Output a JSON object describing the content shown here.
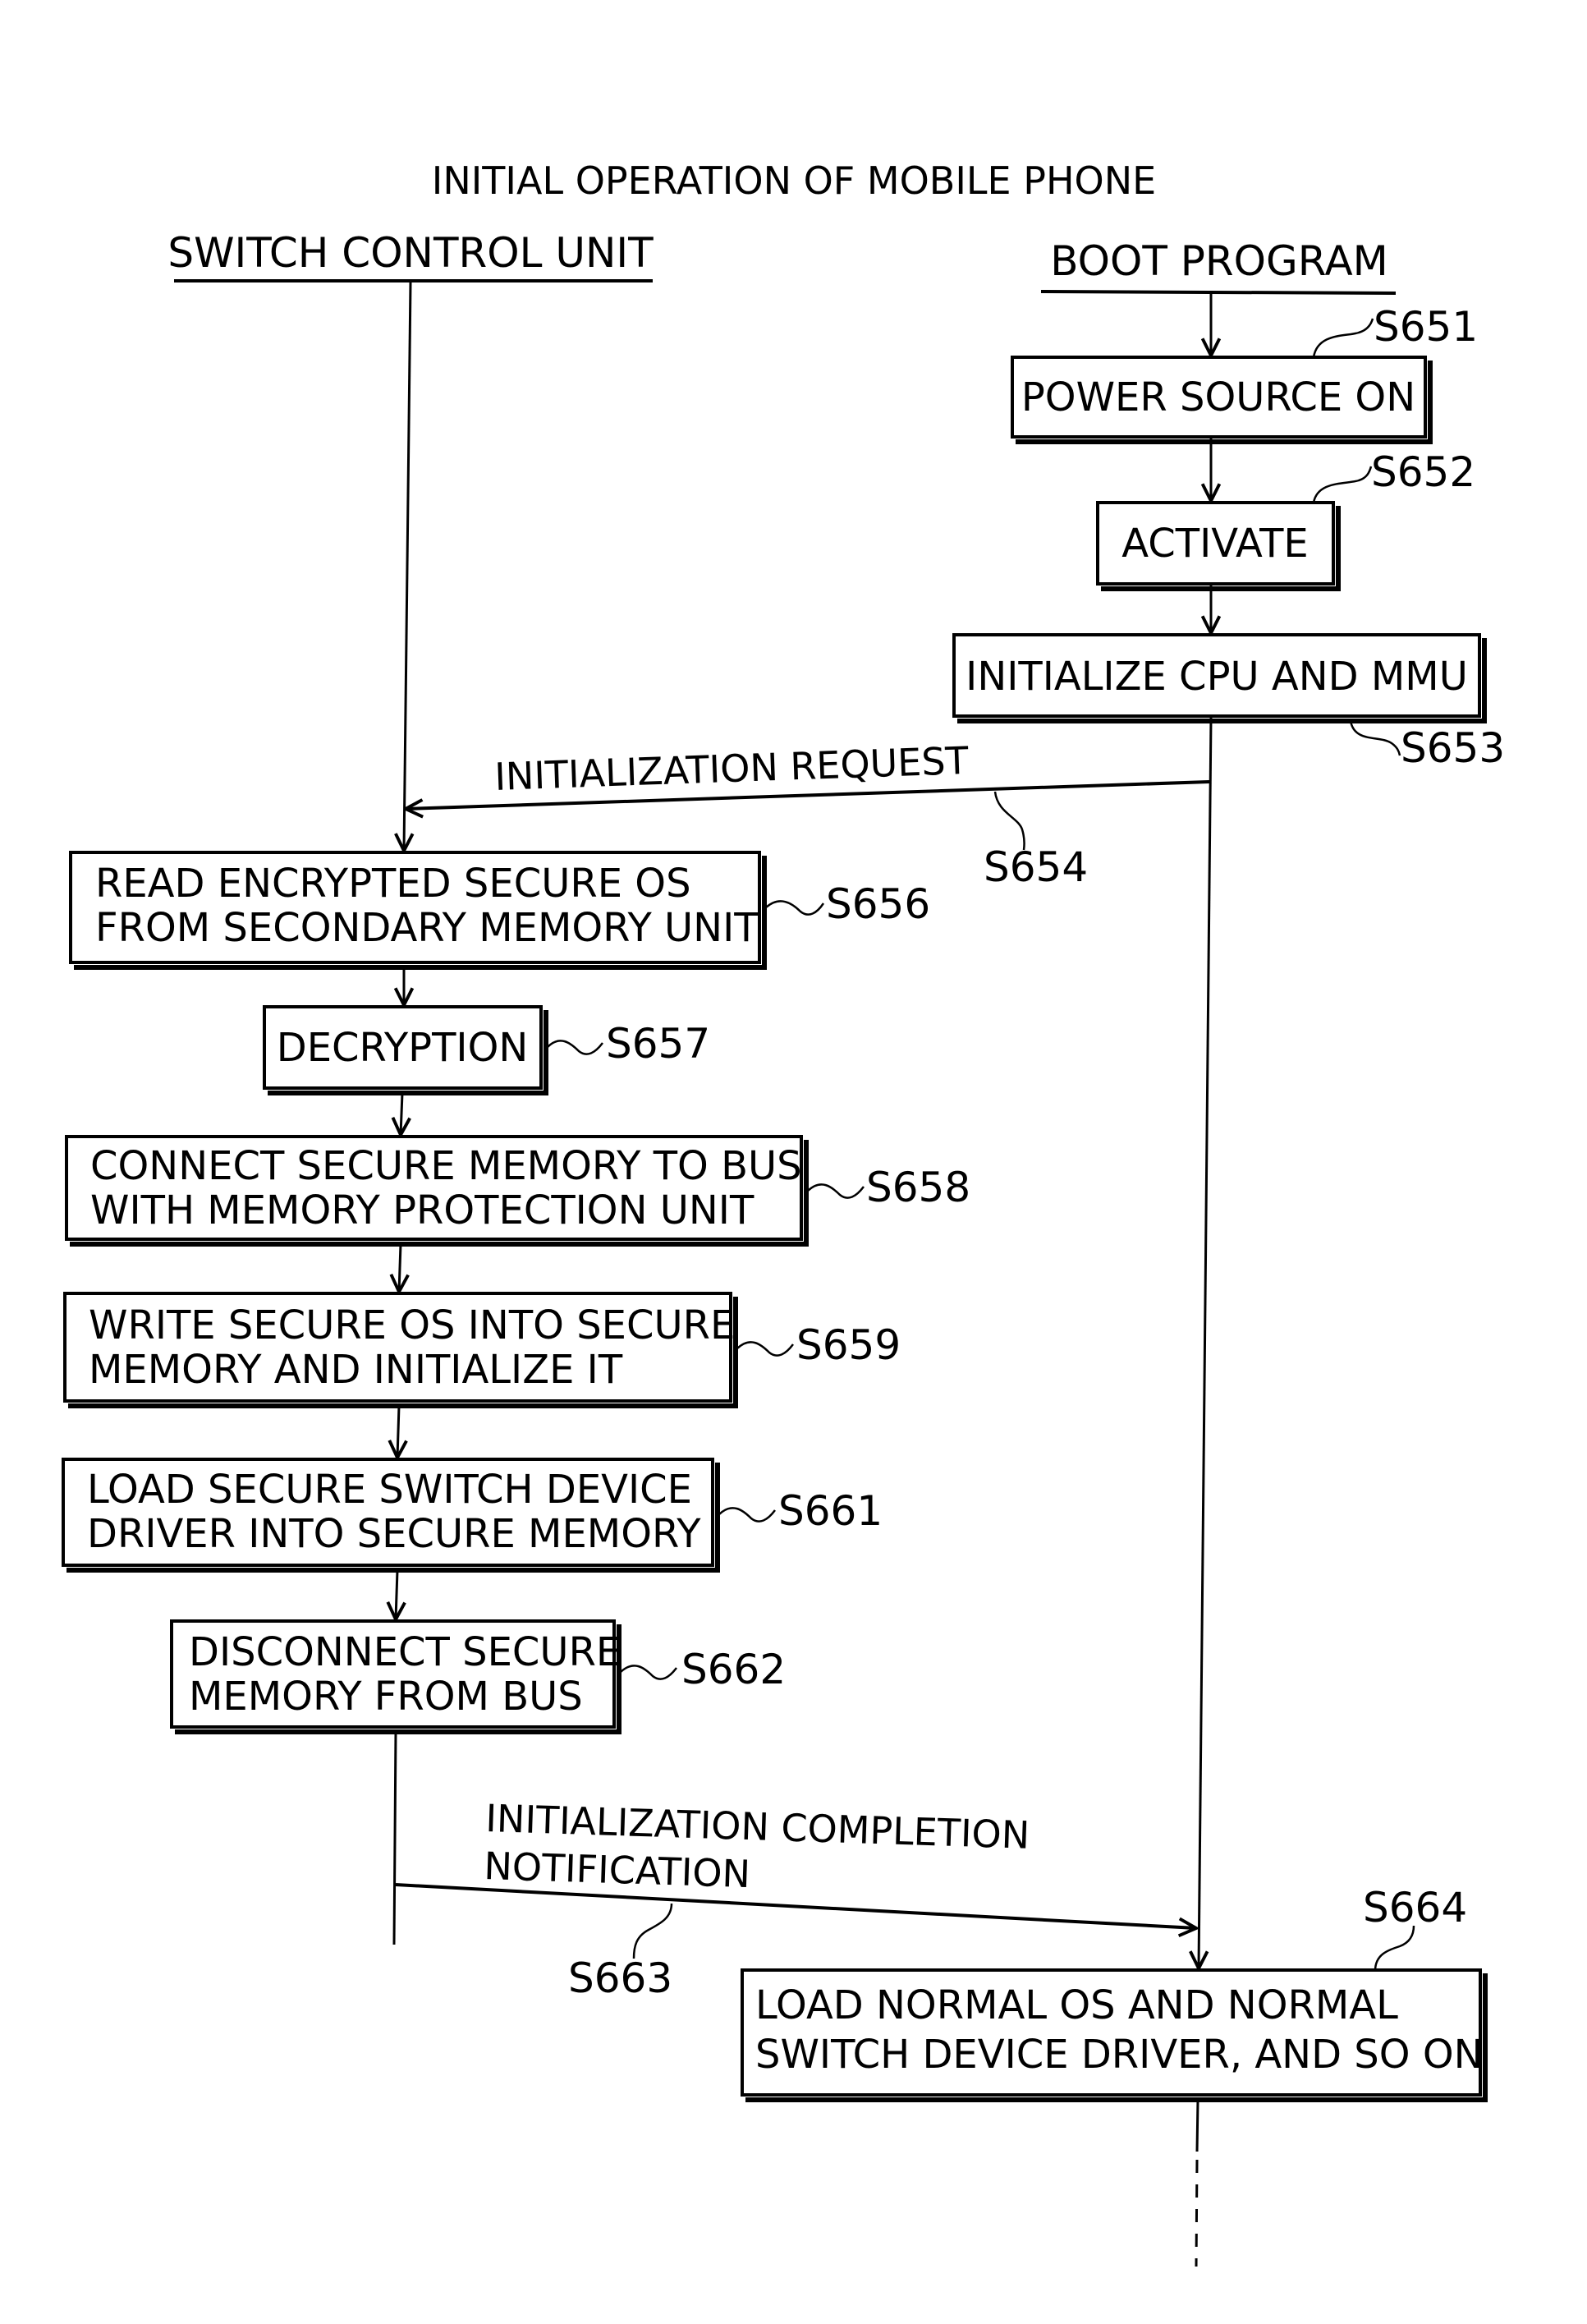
{
  "diagram": {
    "title": "INITIAL OPERATION OF MOBILE PHONE",
    "lanes": {
      "left": "SWITCH CONTROL UNIT",
      "right": "BOOT PROGRAM"
    },
    "steps": {
      "s651": {
        "id": "S651",
        "text": [
          "POWER SOURCE ON"
        ]
      },
      "s652": {
        "id": "S652",
        "text": [
          "ACTIVATE"
        ]
      },
      "s653": {
        "id": "S653",
        "text": [
          "INITIALIZE CPU AND MMU"
        ]
      },
      "s654": {
        "id": "S654",
        "text": [
          "INITIALIZATION REQUEST"
        ]
      },
      "s656": {
        "id": "S656",
        "text": [
          "READ ENCRYPTED SECURE OS",
          "FROM SECONDARY MEMORY UNIT"
        ]
      },
      "s657": {
        "id": "S657",
        "text": [
          "DECRYPTION"
        ]
      },
      "s658": {
        "id": "S658",
        "text": [
          "CONNECT SECURE MEMORY TO BUS",
          "WITH MEMORY PROTECTION UNIT"
        ]
      },
      "s659": {
        "id": "S659",
        "text": [
          "WRITE SECURE OS INTO SECURE",
          "MEMORY AND INITIALIZE IT"
        ]
      },
      "s661": {
        "id": "S661",
        "text": [
          "LOAD SECURE SWITCH DEVICE",
          "DRIVER INTO SECURE MEMORY"
        ]
      },
      "s662": {
        "id": "S662",
        "text": [
          "DISCONNECT SECURE",
          "MEMORY FROM BUS"
        ]
      },
      "s663": {
        "id": "S663",
        "text": [
          "INITIALIZATION COMPLETION",
          "NOTIFICATION"
        ]
      },
      "s664": {
        "id": "S664",
        "text": [
          "LOAD NORMAL OS AND NORMAL",
          "SWITCH DEVICE DRIVER, AND SO ON"
        ]
      }
    }
  }
}
